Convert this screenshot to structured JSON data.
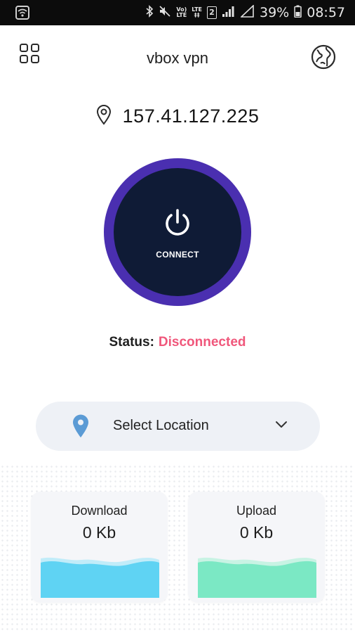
{
  "status_bar": {
    "battery": "39%",
    "time": "08:57",
    "volte_top": "Vo)",
    "volte_bottom": "LTE",
    "lte_top": "LTE",
    "lte_bottom": "‡‡",
    "sim": "2"
  },
  "header": {
    "title": "vbox vpn",
    "menu_icon": "grid-icon",
    "globe_icon": "globe-icon"
  },
  "ip": {
    "address": "157.41.127.225",
    "icon": "location-pin-icon"
  },
  "connect": {
    "label": "CONNECT",
    "icon": "power-icon"
  },
  "status": {
    "label": "Status:",
    "value": "Disconnected",
    "value_color": "#f0577b"
  },
  "location_select": {
    "label": "Select Location",
    "pin_icon": "location-pin-icon",
    "chevron_icon": "chevron-down-icon"
  },
  "stats": {
    "download": {
      "title": "Download",
      "value": "0 Kb"
    },
    "upload": {
      "title": "Upload",
      "value": "0 Kb"
    }
  },
  "colors": {
    "ring": "#4a2fb0",
    "core": "#0f1b36",
    "download_wave": "#5fd3f3",
    "upload_wave": "#7be8c4"
  }
}
